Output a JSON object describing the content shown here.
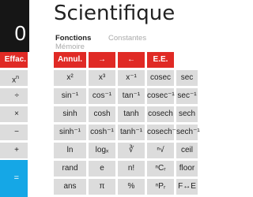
{
  "display": {
    "value": "0"
  },
  "left_keys": [
    "Effac.",
    "x",
    "÷",
    "×",
    "−",
    "+",
    "="
  ],
  "header": {
    "title": "Scientifique"
  },
  "tabs": [
    {
      "label": "Fonctions",
      "active": true
    },
    {
      "label": "Constantes",
      "active": false
    },
    {
      "label": "Mémoire",
      "active": false
    }
  ],
  "function_row": [
    "Annul.",
    "→",
    "←",
    "E.E."
  ],
  "keys": [
    [
      "x²",
      "x³",
      "x⁻¹",
      "cosec",
      "sec"
    ],
    [
      "sin⁻¹",
      "cos⁻¹",
      "tan⁻¹",
      "cosec⁻¹",
      "sec⁻¹"
    ],
    [
      "sinh",
      "cosh",
      "tanh",
      "cosech",
      "sech"
    ],
    [
      "sinh⁻¹",
      "cosh⁻¹",
      "tanh⁻¹",
      "cosech⁻¹",
      "sech⁻¹"
    ],
    [
      "ln",
      "logₓ",
      "∛",
      "ⁿ√",
      "ceil"
    ],
    [
      "rand",
      "e",
      "n!",
      "ⁿCᵣ",
      "floor"
    ],
    [
      "ans",
      "π",
      "%",
      "ⁿPᵣ",
      "F↔E"
    ]
  ],
  "colors": {
    "accent_red": "#e02a25",
    "equals_blue": "#15a7e6",
    "display_bg": "#161616",
    "key_gray": "#dcdcdc"
  }
}
